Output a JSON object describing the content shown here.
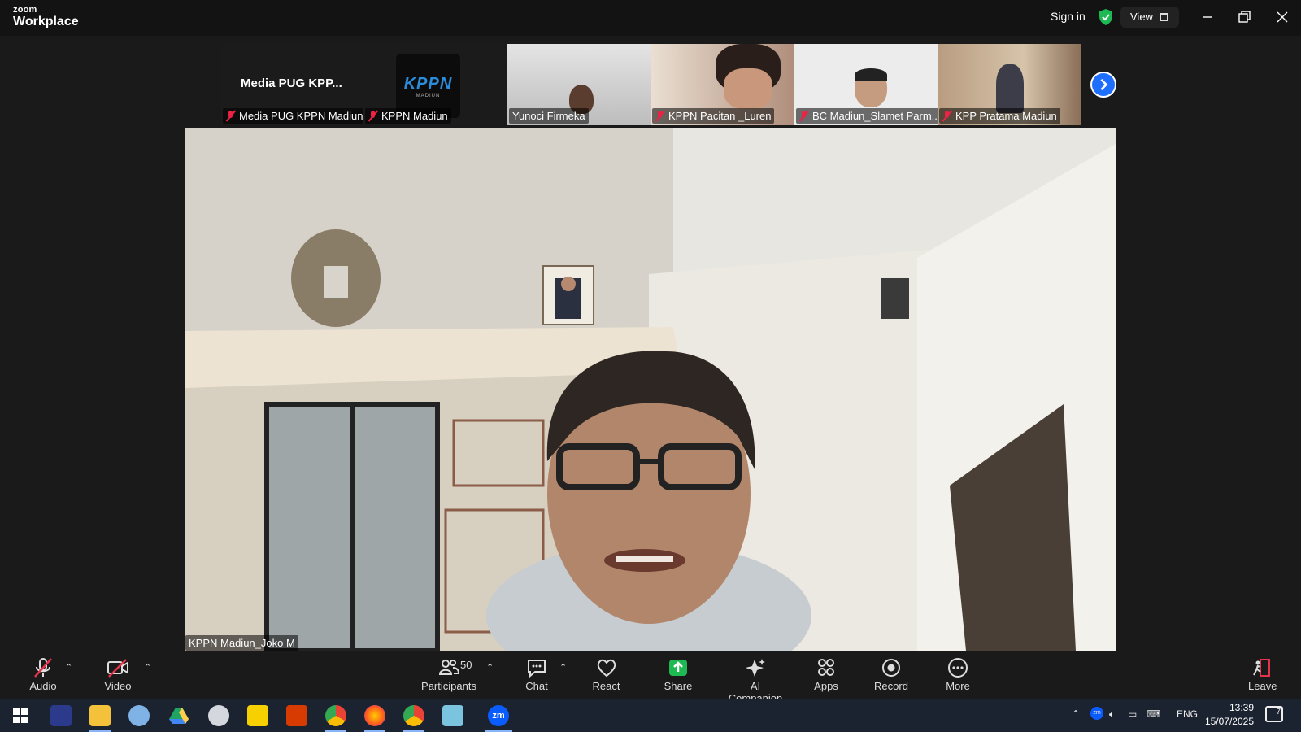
{
  "window": {
    "logo_top": "zoom",
    "logo_bottom": "Workplace",
    "sign_in": "Sign in",
    "view_label": "View",
    "secure_color": "#1fb954"
  },
  "thumbnails": [
    {
      "name": "Media PUG KPPN Madiun",
      "display_title": "Media PUG KPP...",
      "muted": true
    },
    {
      "name": "KPPN Madiun",
      "logo_text": "KPPN",
      "logo_sub": "MADIUN",
      "muted": true
    },
    {
      "name": "Yunoci Firmeka",
      "muted": false
    },
    {
      "name": "KPPN Pacitan _Luren",
      "muted": true
    },
    {
      "name": "BC Madiun_Slamet Parm...",
      "muted": true
    },
    {
      "name": "KPP Pratama Madiun",
      "muted": true
    }
  ],
  "main_speaker": {
    "name": "KPPN Madiun_Joko M"
  },
  "toolbar": {
    "audio": "Audio",
    "video": "Video",
    "participants": "Participants",
    "participants_count": "50",
    "chat": "Chat",
    "react": "React",
    "share": "Share",
    "ai_companion": "AI Companion",
    "apps": "Apps",
    "record": "Record",
    "more": "More",
    "leave": "Leave",
    "share_color": "#1fb954",
    "leave_color": "#e5334b"
  },
  "taskbar": {
    "language": "ENG",
    "time": "13:39",
    "date": "15/07/2025",
    "notification_count": "7",
    "apps": [
      "start",
      "media-player",
      "file-explorer",
      "paint",
      "google-drive",
      "snipping",
      "sticky-notes",
      "office",
      "chrome-profile",
      "firefox",
      "chrome",
      "notepad",
      "zoom"
    ]
  }
}
